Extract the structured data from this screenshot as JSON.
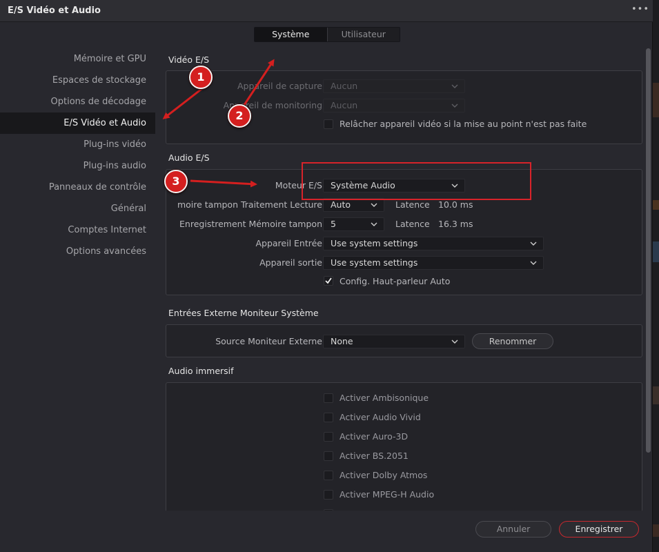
{
  "window": {
    "title": "E/S Vidéo et Audio",
    "more_label": "•••"
  },
  "tabs": [
    {
      "label": "Système",
      "active": true
    },
    {
      "label": "Utilisateur",
      "active": false
    }
  ],
  "sidebar": {
    "items": [
      {
        "label": "Mémoire et GPU"
      },
      {
        "label": "Espaces de stockage"
      },
      {
        "label": "Options de décodage"
      },
      {
        "label": "E/S Vidéo et Audio",
        "active": true
      },
      {
        "label": "Plug-ins vidéo"
      },
      {
        "label": "Plug-ins audio"
      },
      {
        "label": "Panneaux de contrôle"
      },
      {
        "label": "Général"
      },
      {
        "label": "Comptes Internet"
      },
      {
        "label": "Options avancées"
      }
    ]
  },
  "video_io": {
    "title": "Vidéo E/S",
    "capture_label": "Appareil de capture",
    "capture_value": "Aucun",
    "monitoring_label": "Appareil de monitoring",
    "monitoring_value": "Aucun",
    "release_label": "Relâcher appareil vidéo si la mise au point n'est pas faite",
    "release_checked": false
  },
  "audio_io": {
    "title": "Audio E/S",
    "engine_label": "Moteur E/S",
    "engine_value": "Système Audio",
    "playback_buffer_label": "moire tampon Traitement Lecture",
    "playback_buffer_value": "Auto",
    "latency_label": "Latence",
    "playback_latency": "10.0 ms",
    "record_buffer_label": "Enregistrement Mémoire tampon",
    "record_buffer_value": "5",
    "record_latency": "16.3 ms",
    "input_label": "Appareil Entrée",
    "input_value": "Use system settings",
    "output_label": "Appareil sortie",
    "output_value": "Use system settings",
    "auto_speaker_label": "Config. Haut-parleur Auto",
    "auto_speaker_checked": true
  },
  "external_monitor": {
    "title": "Entrées Externe Moniteur Système",
    "source_label": "Source Moniteur Externe",
    "source_value": "None",
    "rename_label": "Renommer"
  },
  "immersive": {
    "title": "Audio immersif",
    "options": [
      {
        "label": "Activer Ambisonique",
        "checked": false
      },
      {
        "label": "Activer Audio Vivid",
        "checked": false
      },
      {
        "label": "Activer Auro-3D",
        "checked": false
      },
      {
        "label": "Activer BS.2051",
        "checked": false
      },
      {
        "label": "Activer Dolby Atmos",
        "checked": false
      },
      {
        "label": "Activer MPEG-H Audio",
        "checked": false
      }
    ]
  },
  "footer": {
    "cancel_label": "Annuler",
    "save_label": "Enregistrer"
  },
  "annotations": {
    "badge1": "1",
    "badge2": "2",
    "badge3": "3"
  },
  "colors": {
    "accent": "#c7282e",
    "annotation_red": "#d41f1f",
    "background": "#28282e"
  }
}
